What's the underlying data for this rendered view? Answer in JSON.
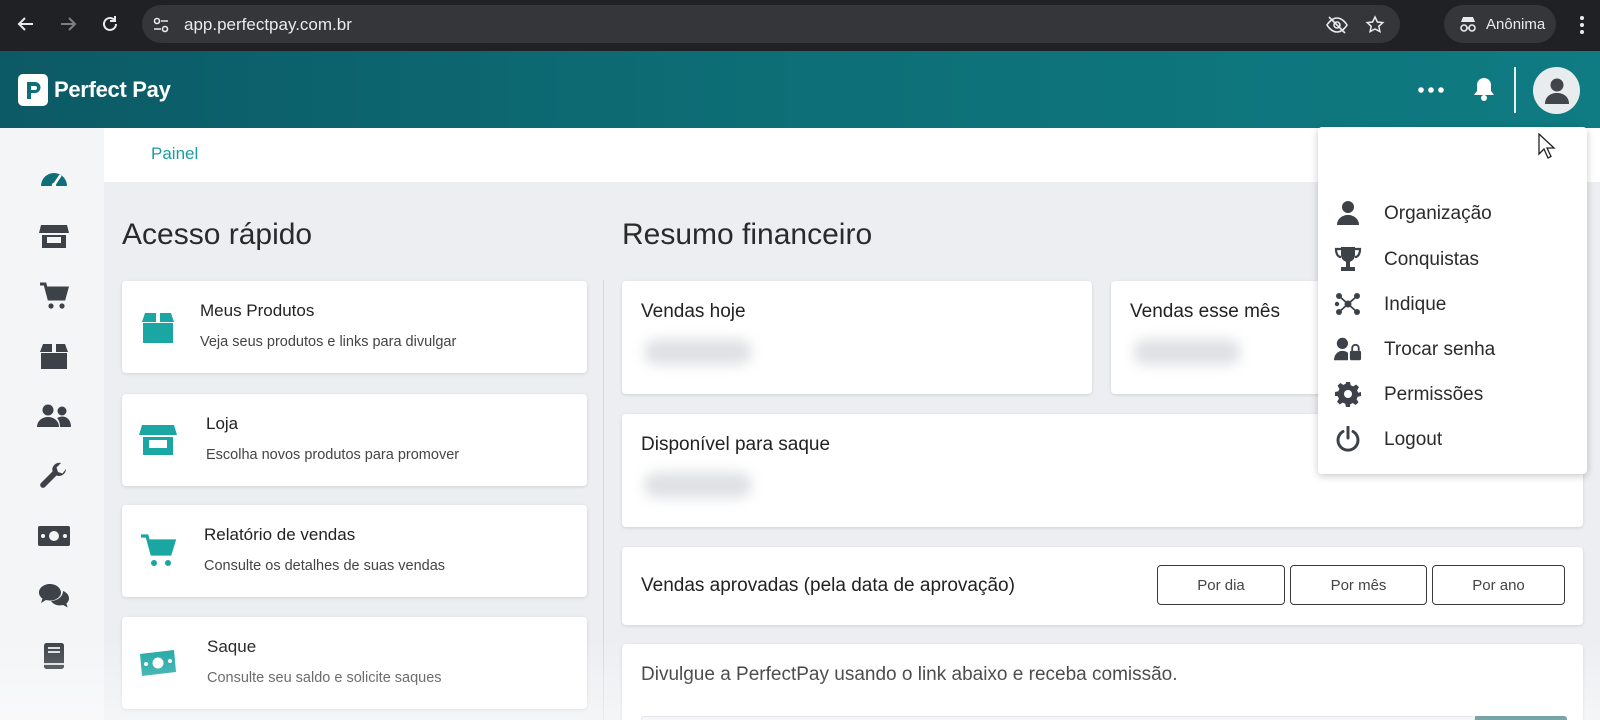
{
  "browser": {
    "url": "app.perfectpay.com.br",
    "profile_label": "Anônima"
  },
  "header": {
    "logo_text": "Perfect Pay"
  },
  "breadcrumb": {
    "label": "Painel"
  },
  "quick_access": {
    "title": "Acesso rápido",
    "items": [
      {
        "title": "Meus Produtos",
        "desc": "Veja seus produtos e links para divulgar",
        "icon": "box-icon"
      },
      {
        "title": "Loja",
        "desc": "Escolha novos produtos para promover",
        "icon": "store-icon"
      },
      {
        "title": "Relatório de vendas",
        "desc": "Consulte os detalhes de suas vendas",
        "icon": "cart-icon"
      },
      {
        "title": "Saque",
        "desc": "Consulte seu saldo e solicite saques",
        "icon": "money-icon"
      }
    ]
  },
  "finance": {
    "title": "Resumo financeiro",
    "sales_today": "Vendas hoje",
    "sales_month": "Vendas esse mês",
    "available": "Disponível para saque",
    "approved_title": "Vendas aprovadas (pela data de aprovação)",
    "btn_day": "Por dia",
    "btn_month": "Por mês",
    "btn_year": "Por ano",
    "promo_text": "Divulgue a PerfectPay usando o link abaixo e receba comissão."
  },
  "user_menu": {
    "items": [
      {
        "label": "Organização",
        "icon": "user-icon"
      },
      {
        "label": "Conquistas",
        "icon": "trophy-icon"
      },
      {
        "label": "Indique",
        "icon": "network-icon"
      },
      {
        "label": "Trocar senha",
        "icon": "user-lock-icon"
      },
      {
        "label": "Permissões",
        "icon": "gear-icon"
      },
      {
        "label": "Logout",
        "icon": "power-icon"
      }
    ]
  },
  "colors": {
    "brand_teal": "#0f7b82",
    "accent": "#14a19b",
    "icon_dark": "#3d4249"
  }
}
